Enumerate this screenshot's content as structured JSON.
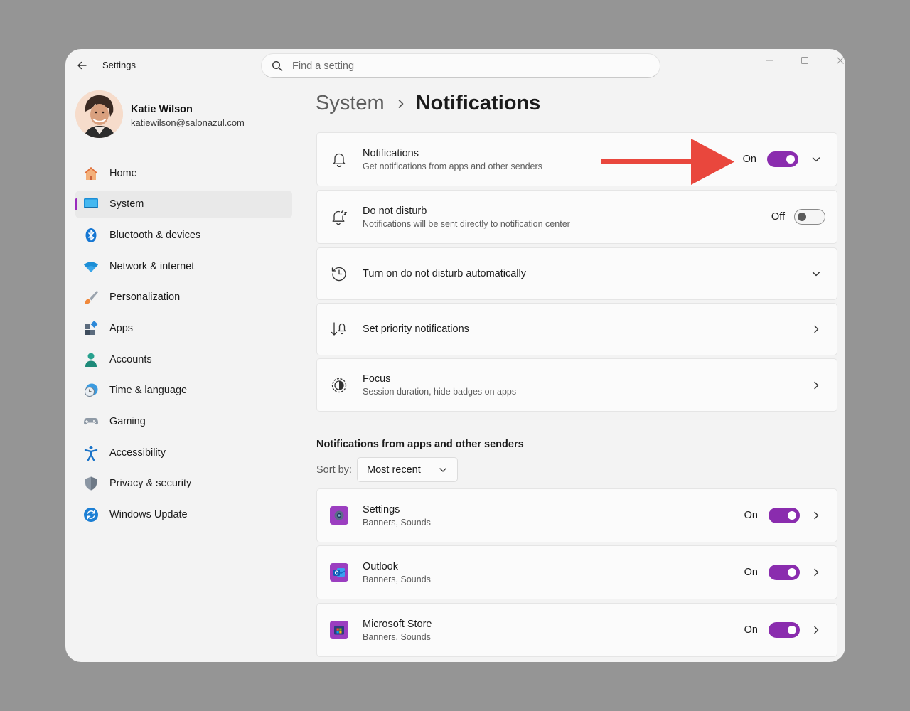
{
  "window": {
    "title": "Settings"
  },
  "search": {
    "placeholder": "Find a setting"
  },
  "profile": {
    "name": "Katie Wilson",
    "email": "katiewilson@salonazul.com"
  },
  "nav": {
    "items": [
      {
        "label": "Home",
        "icon": "home-icon"
      },
      {
        "label": "System",
        "icon": "system-icon",
        "active": true
      },
      {
        "label": "Bluetooth & devices",
        "icon": "bluetooth-icon"
      },
      {
        "label": "Network & internet",
        "icon": "wifi-icon"
      },
      {
        "label": "Personalization",
        "icon": "paintbrush-icon"
      },
      {
        "label": "Apps",
        "icon": "apps-icon"
      },
      {
        "label": "Accounts",
        "icon": "person-icon"
      },
      {
        "label": "Time & language",
        "icon": "clock-globe-icon"
      },
      {
        "label": "Gaming",
        "icon": "gamepad-icon"
      },
      {
        "label": "Accessibility",
        "icon": "accessibility-icon"
      },
      {
        "label": "Privacy & security",
        "icon": "shield-icon"
      },
      {
        "label": "Windows Update",
        "icon": "update-icon"
      }
    ]
  },
  "breadcrumb": {
    "parent": "System",
    "current": "Notifications"
  },
  "settings": [
    {
      "title": "Notifications",
      "subtitle": "Get notifications from apps and other senders",
      "state": "On",
      "toggle": true,
      "icon": "bell-icon"
    },
    {
      "title": "Do not disturb",
      "subtitle": "Notifications will be sent directly to notification center",
      "state": "Off",
      "toggle": false,
      "icon": "bell-snooze-icon"
    },
    {
      "title": "Turn on do not disturb automatically",
      "icon": "clock-icon"
    },
    {
      "title": "Set priority notifications",
      "icon": "priority-icon"
    },
    {
      "title": "Focus",
      "subtitle": "Session duration, hide badges on apps",
      "icon": "focus-icon"
    }
  ],
  "senders_section": {
    "title": "Notifications from apps and other senders",
    "sort_label": "Sort by:",
    "sort_value": "Most recent",
    "apps": [
      {
        "name": "Settings",
        "subtitle": "Banners, Sounds",
        "state": "On",
        "icon": "settings-app-icon"
      },
      {
        "name": "Outlook",
        "subtitle": "Banners, Sounds",
        "state": "On",
        "icon": "outlook-app-icon"
      },
      {
        "name": "Microsoft Store",
        "subtitle": "Banners, Sounds",
        "state": "On",
        "icon": "store-app-icon"
      }
    ]
  },
  "colors": {
    "accent": "#8a2cae",
    "arrow": "#e9473d",
    "backdrop": "#959595",
    "window": "#f3f3f3"
  }
}
